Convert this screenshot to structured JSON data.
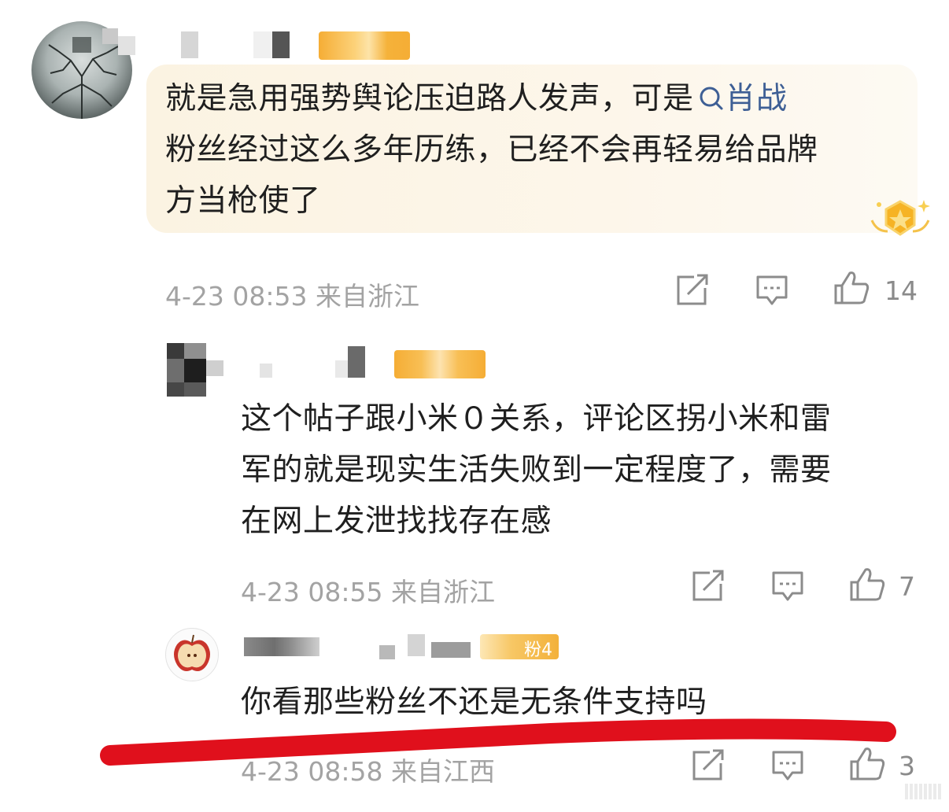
{
  "comments": [
    {
      "text_lines": [
        "就是急用强势舆论压迫路人发声，可是",
        "粉丝经过这么多年历练，已经不会再轻易给品牌",
        "方当枪使了"
      ],
      "mention": "肖战",
      "meta": "4-23 08:53  来自浙江",
      "likes": "14"
    },
    {
      "text_lines": [
        "这个帖子跟小米０关系，评论区拐小米和雷",
        "军的就是现实生活失败到一定程度了，需要",
        "在网上发泄找找存在感"
      ],
      "meta": "4-23 08:55  来自浙江",
      "likes": "7"
    },
    {
      "badge": "粉4",
      "text_lines": [
        "你看那些粉丝不还是无条件支持吗"
      ],
      "meta": "4-23 08:58  来自江西",
      "likes": "3"
    }
  ],
  "colors": {
    "mention": "#3e5f95",
    "meta": "#a3a3a3",
    "badge": "#f5b23a",
    "underline": "#e0101c",
    "vip_bubble": "#fbf3e2"
  },
  "icons": [
    "share-icon",
    "comment-icon",
    "thumbs-up-icon",
    "search-icon",
    "vip-crown-icon"
  ]
}
